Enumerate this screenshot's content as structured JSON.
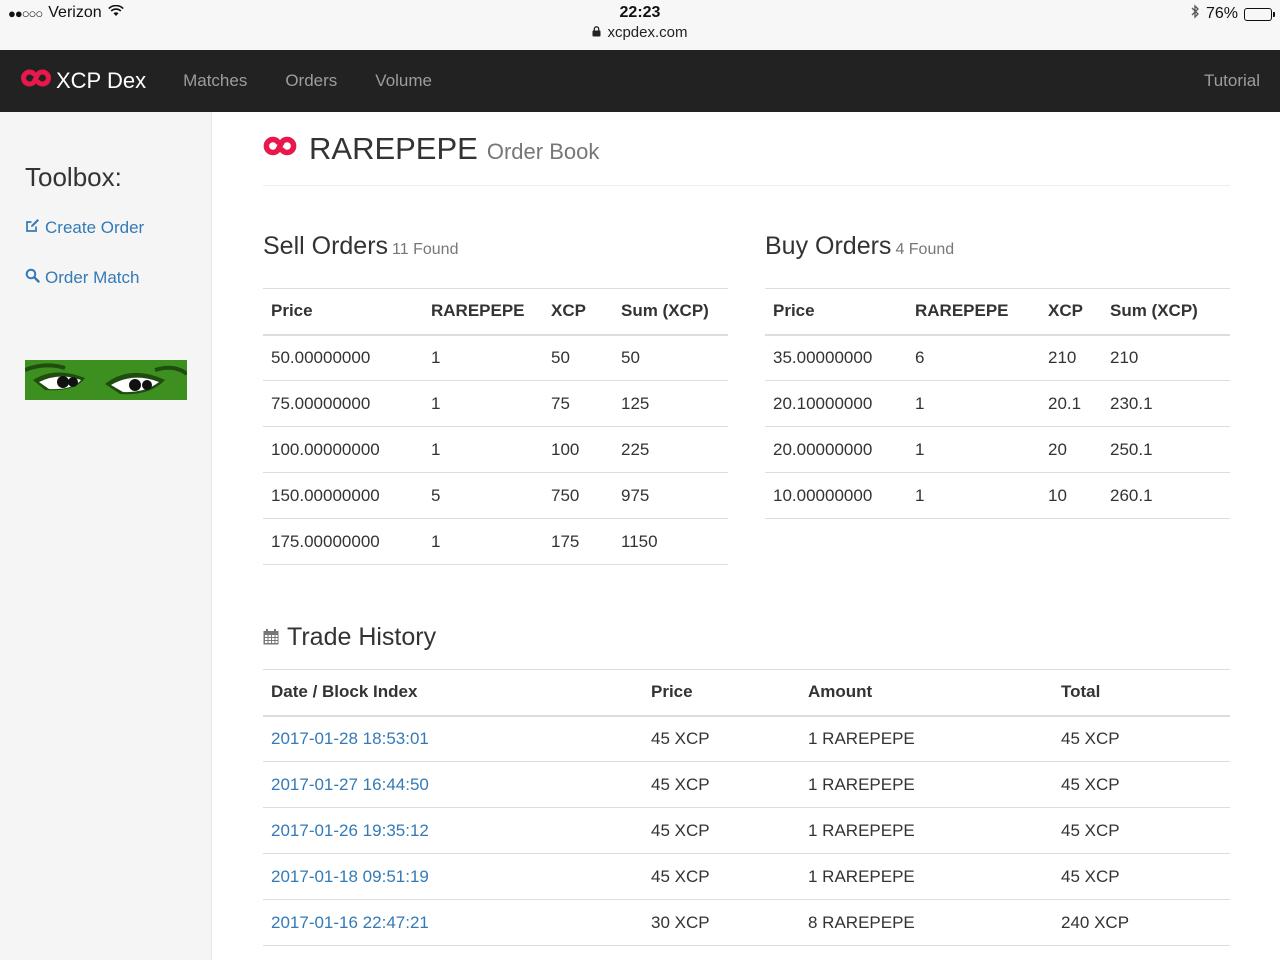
{
  "status_bar": {
    "carrier": "Verizon",
    "signal": "●●○○○",
    "time": "22:23",
    "url": "xcpdex.com",
    "battery": "76%",
    "battery_level": 0.76
  },
  "nav": {
    "brand": "XCP Dex",
    "links": [
      "Matches",
      "Orders",
      "Volume"
    ],
    "right": "Tutorial"
  },
  "sidebar": {
    "title": "Toolbox:",
    "create_order": "Create Order",
    "order_match": "Order Match"
  },
  "header": {
    "asset": "RAREPEPE",
    "subtitle": "Order Book"
  },
  "sell_orders": {
    "title": "Sell Orders",
    "count": "11 Found",
    "columns": [
      "Price",
      "RAREPEPE",
      "XCP",
      "Sum (XCP)"
    ],
    "rows": [
      [
        "50.00000000",
        "1",
        "50",
        "50"
      ],
      [
        "75.00000000",
        "1",
        "75",
        "125"
      ],
      [
        "100.00000000",
        "1",
        "100",
        "225"
      ],
      [
        "150.00000000",
        "5",
        "750",
        "975"
      ],
      [
        "175.00000000",
        "1",
        "175",
        "1150"
      ]
    ]
  },
  "buy_orders": {
    "title": "Buy Orders",
    "count": "4 Found",
    "columns": [
      "Price",
      "RAREPEPE",
      "XCP",
      "Sum (XCP)"
    ],
    "rows": [
      [
        "35.00000000",
        "6",
        "210",
        "210"
      ],
      [
        "20.10000000",
        "1",
        "20.1",
        "230.1"
      ],
      [
        "20.00000000",
        "1",
        "20",
        "250.1"
      ],
      [
        "10.00000000",
        "1",
        "10",
        "260.1"
      ]
    ]
  },
  "trade_history": {
    "title": "Trade History",
    "columns": [
      "Date / Block Index",
      "Price",
      "Amount",
      "Total"
    ],
    "rows": [
      [
        "2017-01-28 18:53:01",
        "45 XCP",
        "1 RAREPEPE",
        "45 XCP"
      ],
      [
        "2017-01-27 16:44:50",
        "45 XCP",
        "1 RAREPEPE",
        "45 XCP"
      ],
      [
        "2017-01-26 19:35:12",
        "45 XCP",
        "1 RAREPEPE",
        "45 XCP"
      ],
      [
        "2017-01-18 09:51:19",
        "45 XCP",
        "1 RAREPEPE",
        "45 XCP"
      ],
      [
        "2017-01-16 22:47:21",
        "30 XCP",
        "8 RAREPEPE",
        "240 XCP"
      ]
    ]
  },
  "colors": {
    "brand": "#e8184b",
    "link": "#337ab7",
    "navbar": "#222222"
  }
}
